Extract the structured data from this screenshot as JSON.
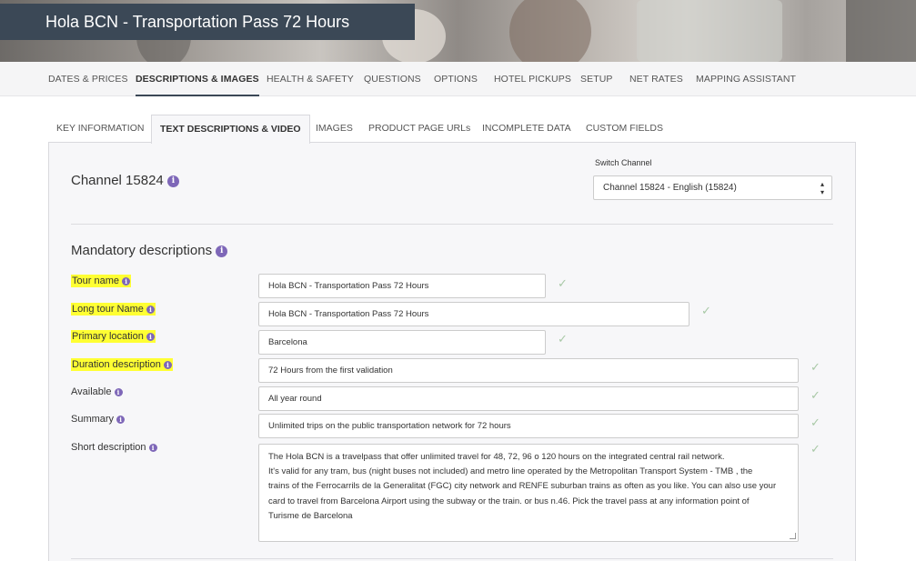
{
  "header": {
    "title": "Hola BCN - Transportation Pass 72 Hours"
  },
  "topnav": [
    "DATES & PRICES",
    "DESCRIPTIONS & IMAGES",
    "HEALTH & SAFETY",
    "QUESTIONS",
    "OPTIONS",
    "HOTEL PICKUPS",
    "SETUP",
    "NET RATES",
    "MAPPING ASSISTANT"
  ],
  "subtabs": [
    "KEY INFORMATION",
    "TEXT DESCRIPTIONS & VIDEO",
    "IMAGES",
    "PRODUCT PAGE URLs",
    "INCOMPLETE DATA",
    "CUSTOM FIELDS"
  ],
  "channel": {
    "title": "Channel 15824",
    "switch_label": "Switch Channel",
    "switch_value": "Channel 15824 - English (15824)"
  },
  "section": {
    "title": "Mandatory descriptions"
  },
  "fields": [
    {
      "label": "Tour name",
      "value": "Hola BCN - Transportation Pass 72 Hours"
    },
    {
      "label": "Long tour Name",
      "value": "Hola BCN - Transportation Pass 72 Hours"
    },
    {
      "label": "Primary location",
      "value": "Barcelona"
    },
    {
      "label": "Duration description",
      "value": "72 Hours from the first validation"
    },
    {
      "label": "Available",
      "value": "All year round"
    },
    {
      "label": "Summary",
      "value": "Unlimited trips on the public transportation network for 72 hours"
    },
    {
      "label": "Short description",
      "value": [
        "The Hola BCN is a travelpass that offer unlimited travel for 48, 72, 96 o 120 hours on the integrated central rail network.",
        "It's valid for any tram, bus (night buses not included) and metro line operated by the Metropolitan Transport System - TMB , the",
        "trains of the Ferrocarrils de la Generalitat (FGC) city network and RENFE  suburban trains as often as you like. You can also use your",
        "card to travel from Barcelona Airport using the subway or the train. or bus n.46. Pick the travel pass at any information point of",
        "Turisme de Barcelona"
      ]
    }
  ],
  "icons": {
    "info": "info-icon",
    "check": "checkmark-icon",
    "select_arrows": "select-arrows-icon"
  },
  "colors": {
    "header_bg": "#3b4856",
    "info_icon": "#7e67b8",
    "highlight": "#ffff33",
    "check": "#a9c9a7"
  }
}
